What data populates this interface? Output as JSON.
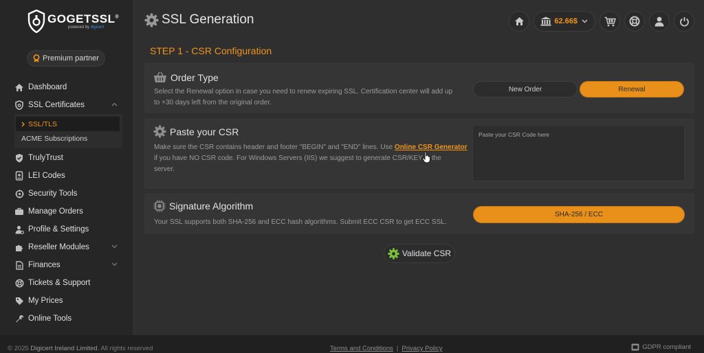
{
  "brand": {
    "name": "GOGETSSL",
    "reg": "®",
    "powered_prefix": "powered by",
    "powered_by": "digicert"
  },
  "partner": {
    "label": "Premium partner"
  },
  "nav": {
    "items": [
      {
        "label": "Dashboard",
        "icon": "home-icon"
      },
      {
        "label": "SSL Certificates",
        "icon": "shield-icon",
        "expandable": true
      },
      {
        "label": "TrulyTrust",
        "icon": "check-shield-icon"
      },
      {
        "label": "LEI Codes",
        "icon": "lei-icon"
      },
      {
        "label": "Security Tools",
        "icon": "security-tools-icon"
      },
      {
        "label": "Manage Orders",
        "icon": "briefcase-icon"
      },
      {
        "label": "Profile & Settings",
        "icon": "user-gear-icon"
      },
      {
        "label": "Reseller Modules",
        "icon": "puzzle-icon",
        "expandable": true
      },
      {
        "label": "Finances",
        "icon": "document-icon",
        "expandable": true
      },
      {
        "label": "Tickets & Support",
        "icon": "lifebuoy-icon"
      },
      {
        "label": "My Prices",
        "icon": "tag-icon"
      },
      {
        "label": "Online Tools",
        "icon": "wrench-icon"
      }
    ],
    "sub": [
      {
        "label": "SSL/TLS",
        "active": true
      },
      {
        "label": "ACME Subscriptions",
        "active": false
      }
    ]
  },
  "header": {
    "title": "SSL Generation",
    "balance": "62.66$"
  },
  "step_title": "STEP 1 - CSR Configuration",
  "order_type": {
    "title": "Order Type",
    "desc_line1": "Select the Renewal option in case you need to renew expiring SSL. Certification center will add up",
    "desc_line2": "to +30 days left from the original order.",
    "new_label": "New Order",
    "renewal_label": "Renewal"
  },
  "paste_csr": {
    "title": "Paste your CSR",
    "desc_line1_before": "Make sure the CSR contains header and footer \"BEGIN\" and \"END\" lines. Use ",
    "link": "Online CSR Generator",
    "desc_line2": "if you have NO CSR code. For Windows Servers (IIS) we suggest to generate CSR/KEY in the",
    "desc_line3": "server.",
    "placeholder": "Paste your CSR Code here"
  },
  "signature": {
    "title": "Signature Algorithm",
    "desc": "Your SSL supports both SHA-256 and ECC hash algorithms. Submit ECC CSR to get ECC SSL.",
    "button": "SHA-256 / ECC"
  },
  "validate_label": "Validate CSR",
  "footer": {
    "copyright_prefix": "© 2025 ",
    "company": "Digicert Ireland Limited.",
    "rights": " All rights reserved",
    "terms": "Terms and Conditions",
    "sep": "|",
    "privacy": "Privacy Policy",
    "gdpr": "GDPR compliant"
  },
  "colors": {
    "accent": "#f2941a",
    "sidebar": "#262626",
    "background": "#2f2f2f",
    "card": "#353535"
  }
}
